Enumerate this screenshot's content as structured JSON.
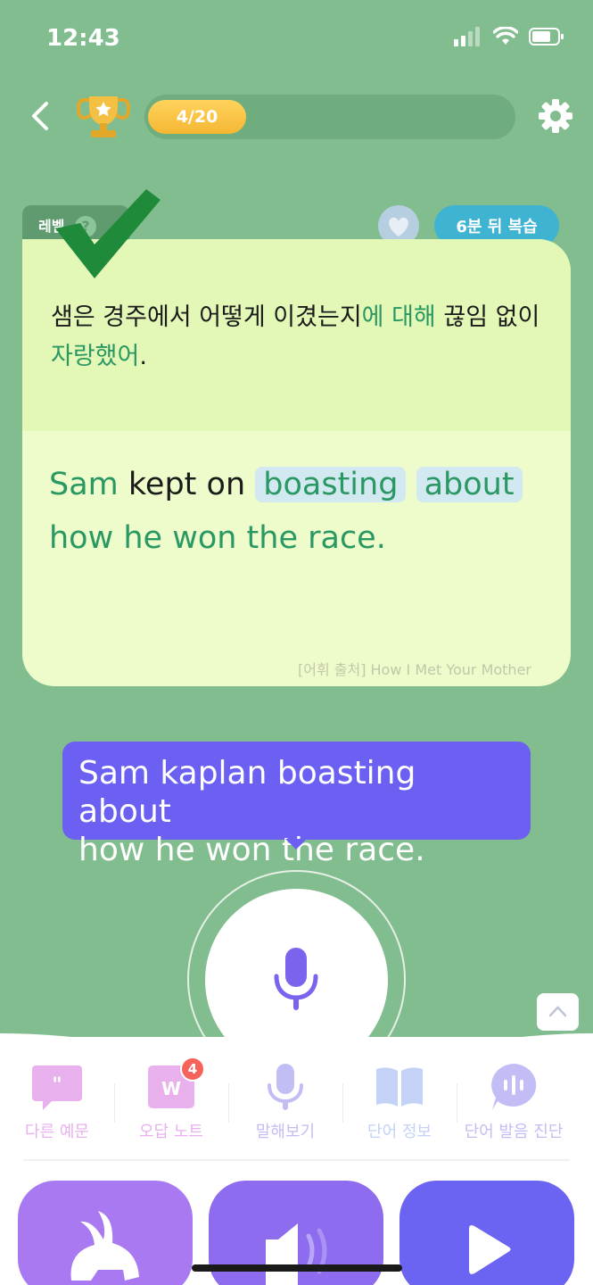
{
  "status": {
    "time": "12:43"
  },
  "progress": {
    "label": "4/20",
    "current": 4,
    "total": 20
  },
  "card": {
    "level_label": "레벨",
    "level_help": "?",
    "review_label": "6분 뒤 복습",
    "korean": {
      "part1": "샘은 경주에서 어떻게 이겼는지",
      "part2": "에 대해",
      "part3": " 끊임 없이 ",
      "part4": "자랑했어",
      "part5": "."
    },
    "english": {
      "w1": "Sam",
      "w2": "kept on",
      "w3": "boasting",
      "w4": "about",
      "w5": "how he won the race."
    },
    "source": "[어휘 출처] How I Met Your Mother"
  },
  "speech_bubble": {
    "text_line1": "Sam kaplan boasting about",
    "text_line2": "how he won the race."
  },
  "tools": [
    {
      "label": "다른 예문",
      "icon": "quote-icon",
      "color": "#e8b1ee"
    },
    {
      "label": "오답 노트",
      "icon": "w-note-icon",
      "color": "#e8b1ee",
      "badge": "4"
    },
    {
      "label": "말해보기",
      "icon": "mic-icon",
      "color": "#c3bdf6"
    },
    {
      "label": "단어 정보",
      "icon": "book-icon",
      "color": "#c3d2f6"
    },
    {
      "label": "단어 발음 진단",
      "icon": "pronunciation-icon",
      "color": "#c3bdf6"
    }
  ],
  "colors": {
    "bg": "#82bd8f",
    "accent_green": "#2a9863",
    "purple": "#6b60f2"
  }
}
